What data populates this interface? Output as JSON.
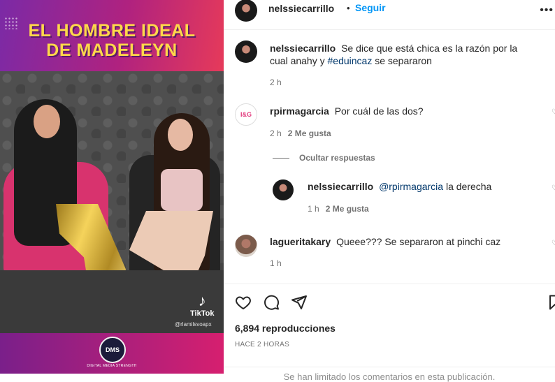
{
  "media": {
    "headline_line1": "EL HOMBRE IDEAL",
    "headline_line2": "DE MADELEYN",
    "tiktok_brand": "TikTok",
    "tiktok_handle": "@rlamilsvoapx",
    "logo_text": "DMS",
    "logo_caption": "DIGITAL MEDIA STRENGTH"
  },
  "post_header": {
    "username": "nelssiecarrillo",
    "separator": "•",
    "follow_label": "Seguir",
    "more_icon": "more-horizontal-icon"
  },
  "caption": {
    "username": "nelssiecarrillo",
    "text_before": "Se dice que está chica es la razón por la cual anahy y",
    "hashtag": "#eduincaz",
    "text_after": "se separaron",
    "time": "2 h"
  },
  "comments": [
    {
      "username": "rpirmagarcia",
      "text": "Por cuál de las dos?",
      "time": "2 h",
      "likes": "2 Me gusta",
      "avatar_text": "I&G",
      "replies_toggle": "Ocultar respuestas",
      "reply": {
        "username": "nelssiecarrillo",
        "mention": "@rpirmagarcia",
        "text": "la derecha",
        "time": "1 h",
        "likes": "2 Me gusta"
      }
    },
    {
      "username": "lagueritakary",
      "text": "Queee??? Se separaron at pinchi caz",
      "time": "1 h"
    }
  ],
  "actions": {
    "icons": [
      "heart-icon",
      "comment-icon",
      "share-icon",
      "bookmark-icon"
    ],
    "views": "6,894 reproducciones",
    "posted_ago": "HACE 2 HORAS",
    "limited_notice": "Se han limitado los comentarios en esta publicación."
  },
  "colors": {
    "link_blue": "#0095f6",
    "hashtag_blue": "#00376b",
    "headline_yellow": "#ffd84a",
    "muted_gray": "#737373"
  }
}
